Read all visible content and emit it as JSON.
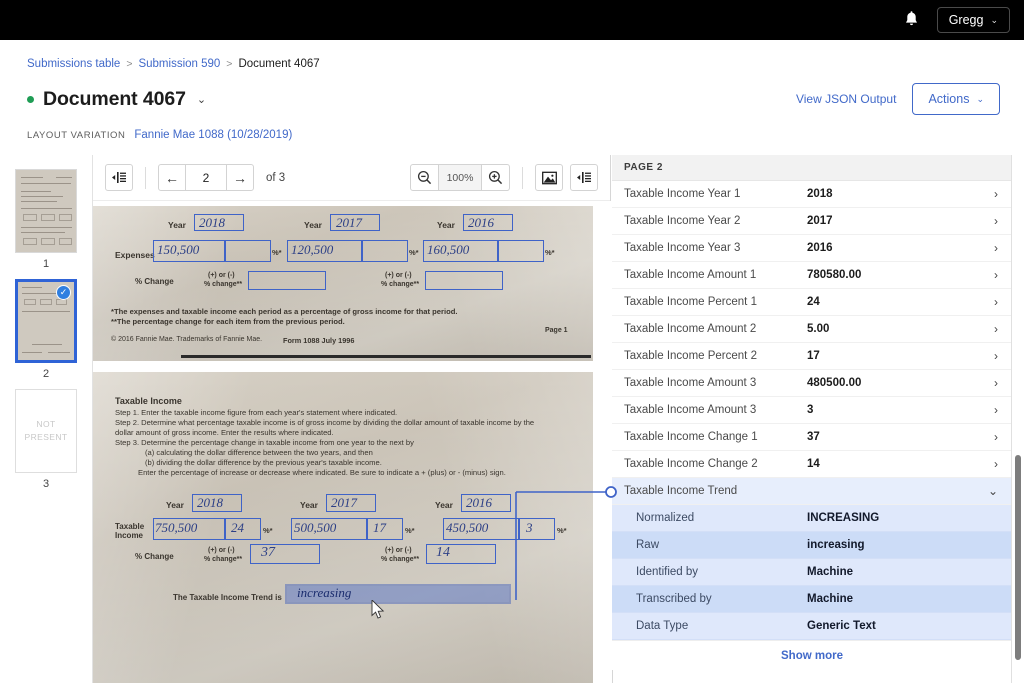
{
  "topbar": {
    "notification_icon": "bell-icon",
    "user_name": "Gregg",
    "user_chevron": "⌄"
  },
  "breadcrumb": {
    "items": [
      {
        "label": "Submissions table",
        "link": true
      },
      {
        "label": "Submission 590",
        "link": true
      },
      {
        "label": "Document 4067",
        "link": false
      }
    ],
    "separator": ">"
  },
  "header": {
    "title": "Document 4067",
    "title_chevron": "⌄",
    "status_color": "#1f9d55",
    "view_json_label": "View JSON Output",
    "actions_label": "Actions",
    "actions_chevron": "⌄",
    "layout_variation_label": "LAYOUT VARIATION",
    "layout_variation_value": "Fannie Mae 1088 (10/28/2019)",
    "accent_color": "#4169c9"
  },
  "thumbnails": [
    {
      "number": "1",
      "state": "page",
      "selected": false
    },
    {
      "number": "2",
      "state": "page",
      "selected": true,
      "badge": "✓"
    },
    {
      "number": "3",
      "state": "not-present",
      "placeholder": "NOT PRESENT"
    }
  ],
  "toolbar": {
    "left_panel_icon": "panel-toggle-icon",
    "prev_label": "←",
    "page_number": "2",
    "next_label": "→",
    "of_label": "of 3",
    "zoom_out_icon": "zoom-out-icon",
    "zoom_level": "100%",
    "zoom_in_icon": "zoom-in-icon",
    "image_icon": "image-icon",
    "right_panel_icon": "panel-toggle-icon"
  },
  "document": {
    "top_section": {
      "year_label": "Year",
      "years": [
        "2018",
        "2017",
        "2016"
      ],
      "row_label": "Expenses",
      "amounts": [
        "150,500",
        "120,500",
        "160,500"
      ],
      "percent_mark": "%*",
      "change_label": "% Change",
      "change_note": "(+) or (-)\n% change**",
      "footnote_1": "*The expenses and taxable income each period as a percentage of gross income for that period.",
      "footnote_2": "**The percentage change for each item from the previous period.",
      "copyright": "© 2016 Fannie Mae. Trademarks of Fannie Mae.",
      "form_id": "Form 1088  July 1996",
      "page_mark": "Page 1"
    },
    "bottom_section": {
      "heading": "Taxable Income",
      "steps": [
        "Step 1. Enter the taxable income figure from each year's statement where indicated.",
        "Step 2. Determine what percentage taxable income is of gross income by dividing the dollar amount of taxable income by the",
        "dollar amount of gross income. Enter the results where indicated.",
        "Step 3. Determine the percentage change in taxable income from one year to the next by",
        "(a) calculating the dollar difference between the two years, and then",
        "(b) dividing the dollar difference by the previous year's taxable income.",
        "Enter the percentage of increase or decrease where indicated. Be sure to indicate a + (plus) or - (minus) sign."
      ],
      "year_label": "Year",
      "years": [
        "2018",
        "2017",
        "2016"
      ],
      "row_label": "Taxable Income",
      "amounts": [
        "750,500",
        "500,500",
        "450,500"
      ],
      "percents": [
        "24",
        "17",
        "3"
      ],
      "percent_mark": "%*",
      "change_label": "% Change",
      "change_note": "(+) or (-)\n% change**",
      "changes": [
        "37",
        "14"
      ],
      "trend_label": "The Taxable Income Trend is",
      "trend_value": "increasing"
    }
  },
  "panel": {
    "page_header": "PAGE 2",
    "fields": [
      {
        "label": "Taxable Income Year 1",
        "value": "2018",
        "chevron": "›"
      },
      {
        "label": "Taxable Income Year 2",
        "value": "2017",
        "chevron": "›"
      },
      {
        "label": "Taxable Income Year 3",
        "value": "2016",
        "chevron": "›"
      },
      {
        "label": "Taxable Income Amount 1",
        "value": "780580.00",
        "chevron": "›"
      },
      {
        "label": "Taxable Income Percent 1",
        "value": "24",
        "chevron": "›"
      },
      {
        "label": "Taxable Income Amount 2",
        "value": "5.00",
        "chevron": "›"
      },
      {
        "label": "Taxable Income Percent 2",
        "value": "17",
        "chevron": "›"
      },
      {
        "label": "Taxable Income Amount 3",
        "value": "480500.00",
        "chevron": "›"
      },
      {
        "label": "Taxable Income Amount 3",
        "value": "3",
        "chevron": "›"
      },
      {
        "label": "Taxable Income Change 1",
        "value": "37",
        "chevron": "›"
      },
      {
        "label": "Taxable Income Change 2",
        "value": "14",
        "chevron": "›"
      }
    ],
    "expanded_group": {
      "label": "Taxable Income Trend",
      "chevron": "⌄",
      "rows": [
        {
          "label": "Normalized",
          "value": "INCREASING"
        },
        {
          "label": "Raw",
          "value": "increasing"
        },
        {
          "label": "Identified by",
          "value": "Machine"
        },
        {
          "label": "Transcribed by",
          "value": "Machine"
        },
        {
          "label": "Data Type",
          "value": "Generic Text"
        }
      ]
    },
    "show_more_label": "Show more"
  }
}
